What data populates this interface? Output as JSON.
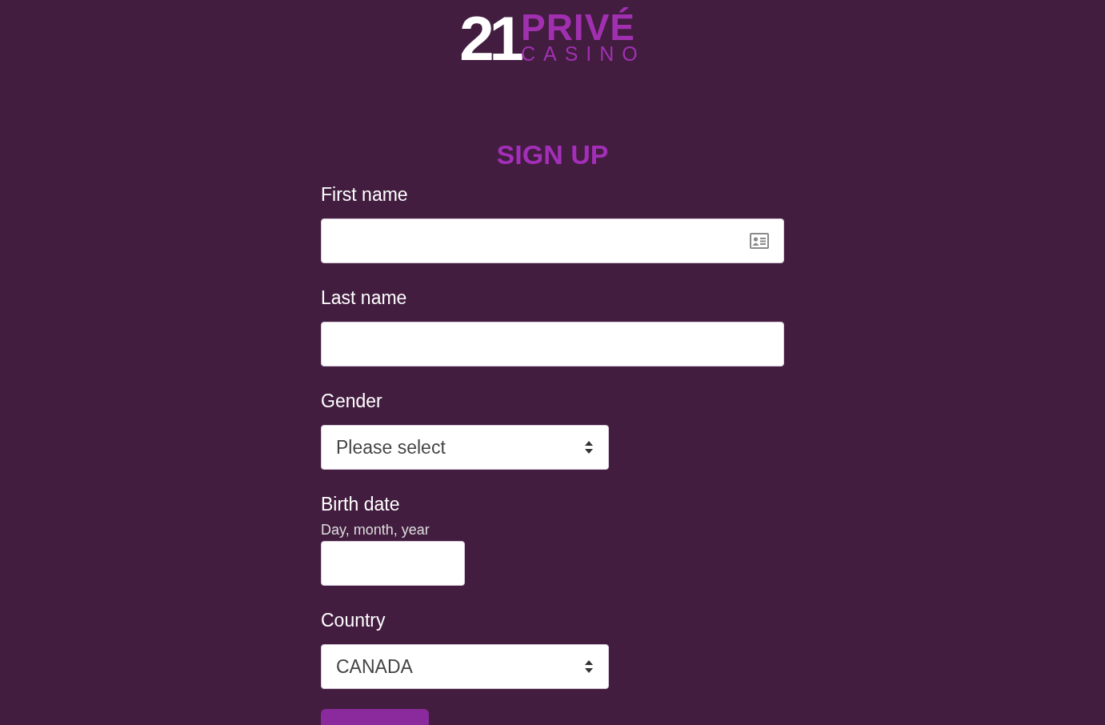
{
  "logo": {
    "number": "21",
    "name": "PRIVÉ",
    "tagline": "CASINO"
  },
  "title": "SIGN UP",
  "fields": [
    {
      "kind": "text",
      "label": "First name",
      "icon": true
    },
    {
      "kind": "text",
      "label": "Last name",
      "icon": false
    },
    {
      "kind": "select",
      "label": "Gender",
      "value": "Please select"
    },
    {
      "kind": "date",
      "label": "Birth date",
      "hint": "Day, month, year"
    },
    {
      "kind": "select",
      "label": "Country",
      "value": "CANADA"
    }
  ]
}
